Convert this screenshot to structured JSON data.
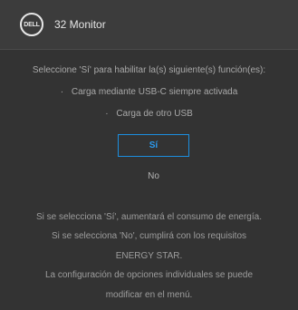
{
  "header": {
    "logo": "DELL",
    "title": "32 Monitor"
  },
  "prompt": "Seleccione 'Sí' para habilitar la(s) siguiente(s) función(es):",
  "features": [
    "Carga mediante USB-C siempre activada",
    "Carga de otro USB"
  ],
  "bullet": "·",
  "buttons": {
    "yes_label": "Sí",
    "no_label": "No"
  },
  "notes": [
    "Si se selecciona 'Sí', aumentará el consumo de energía.",
    "Si se selecciona 'No', cumplirá con los requisitos",
    "ENERGY STAR.",
    "La configuración de opciones individuales se puede",
    "modificar en el menú."
  ],
  "colors": {
    "accent": "#1c8fe0",
    "background": "#333333",
    "text": "#a9a9a9"
  }
}
